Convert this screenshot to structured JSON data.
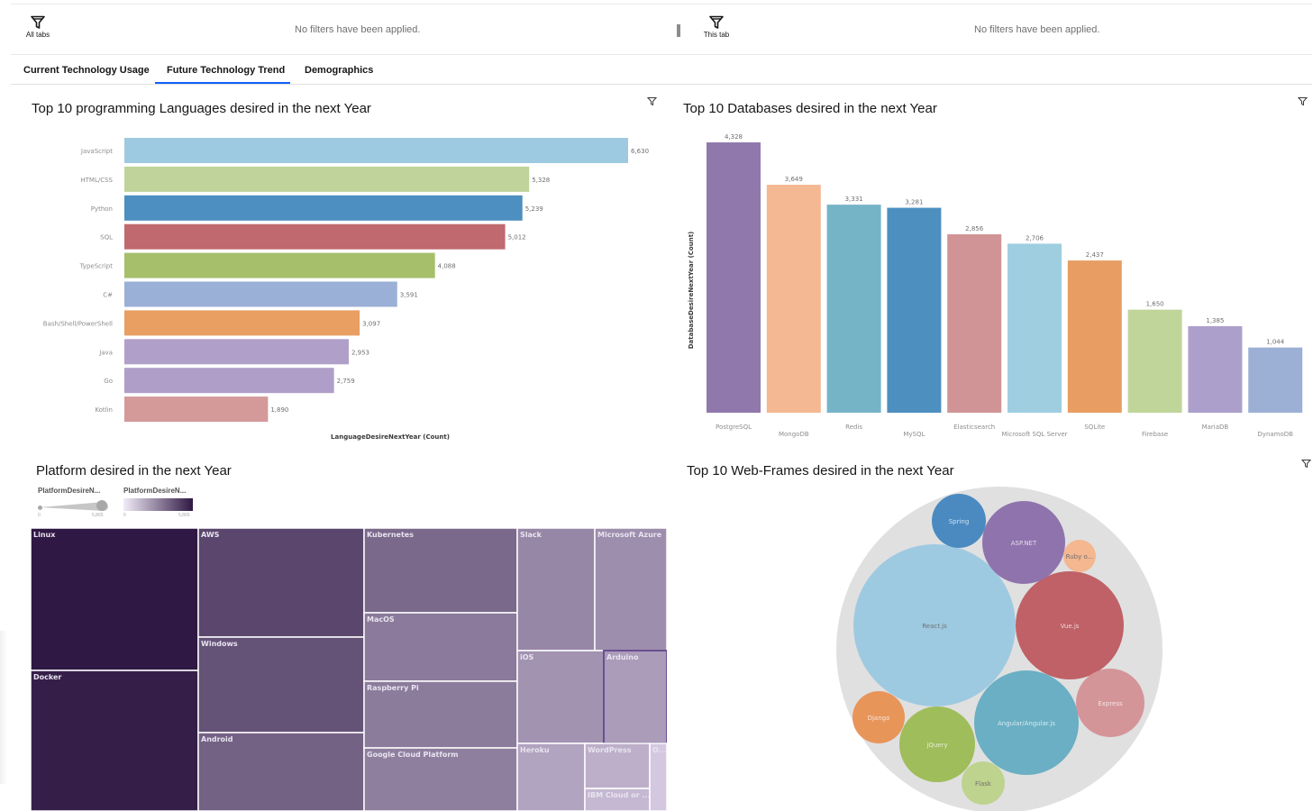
{
  "filters": {
    "all_tabs_label": "All tabs",
    "this_tab_label": "This tab",
    "left_message": "No filters have been applied.",
    "right_message": "No filters have been applied."
  },
  "tabs": [
    {
      "label": "Current Technology Usage",
      "active": false
    },
    {
      "label": "Future Technology Trend",
      "active": true
    },
    {
      "label": "Demographics",
      "active": false
    }
  ],
  "panels": {
    "languages_title": "Top 10 programming Languages desired in the next Year",
    "databases_title": "Top 10 Databases desired in the next Year",
    "platforms_title": "Platform desired in the next Year",
    "webframes_title": "Top 10 Web-Frames desired in the next Year"
  },
  "legend": {
    "size_title": "PlatformDesireN...",
    "color_title": "PlatformDesireN...",
    "size_min": "0",
    "size_max": "5,865",
    "color_min": "0",
    "color_max": "5,865"
  },
  "chart_data": [
    {
      "type": "bar",
      "orientation": "horizontal",
      "title": "Top 10 programming Languages desired in the next Year",
      "xlabel": "LanguageDesireNextYear (Count)",
      "ylabel": "",
      "categories": [
        "JavaScript",
        "HTML/CSS",
        "Python",
        "SQL",
        "TypeScript",
        "C#",
        "Bash/Shell/PowerShell",
        "Java",
        "Go",
        "Kotlin"
      ],
      "values": [
        6630,
        5328,
        5239,
        5012,
        4088,
        3591,
        3097,
        2953,
        2759,
        1890
      ],
      "value_labels": [
        "6,630",
        "5,328",
        "5,239",
        "5,012",
        "4,088",
        "3,591",
        "3,097",
        "2,953",
        "2,759",
        "1,890"
      ],
      "colors": [
        "#9ecae1",
        "#c0d39a",
        "#4d8fc0",
        "#c0696e",
        "#a5bf6b",
        "#9ab0d6",
        "#e99e62",
        "#b09fc9",
        "#ae9ec8",
        "#d49999"
      ],
      "xlim": [
        0,
        6630
      ]
    },
    {
      "type": "bar",
      "orientation": "vertical",
      "title": "Top 10 Databases desired in the next Year",
      "xlabel": "",
      "ylabel": "DatabaseDesireNextYear (Count)",
      "categories": [
        "PostgreSQL",
        "MongoDB",
        "Redis",
        "MySQL",
        "Elasticsearch",
        "Microsoft SQL Server",
        "SQLite",
        "Firebase",
        "MariaDB",
        "DynamoDB"
      ],
      "values": [
        4328,
        3649,
        3331,
        3281,
        2856,
        2706,
        2437,
        1650,
        1385,
        1044
      ],
      "value_labels": [
        "4,328",
        "3,649",
        "3,331",
        "3,281",
        "2,856",
        "2,706",
        "2,437",
        "1,650",
        "1,385",
        "1,044"
      ],
      "colors": [
        "#9078ad",
        "#f4b892",
        "#75b4c7",
        "#4d8fbf",
        "#d19496",
        "#9ecee0",
        "#e89e63",
        "#c0d59a",
        "#ad9fcb",
        "#9cb0d6"
      ],
      "ylim": [
        0,
        4328
      ]
    },
    {
      "type": "treemap",
      "title": "Platform desired in the next Year",
      "items": [
        {
          "name": "Linux",
          "value": 5865
        },
        {
          "name": "Docker",
          "value": 5600
        },
        {
          "name": "AWS",
          "value": 4100
        },
        {
          "name": "Windows",
          "value": 3700
        },
        {
          "name": "Android",
          "value": 3150
        },
        {
          "name": "Kubernetes",
          "value": 2900
        },
        {
          "name": "MacOS",
          "value": 2350
        },
        {
          "name": "Raspberry Pi",
          "value": 2300
        },
        {
          "name": "Google Cloud Platform",
          "value": 2200
        },
        {
          "name": "Slack",
          "value": 1950
        },
        {
          "name": "Microsoft Azure",
          "value": 1750
        },
        {
          "name": "iOS",
          "value": 1600
        },
        {
          "name": "Arduino",
          "value": 1350
        },
        {
          "name": "Heroku",
          "value": 1150
        },
        {
          "name": "WordPress",
          "value": 850
        },
        {
          "name": "IBM Cloud or ...",
          "value": 650
        },
        {
          "name": "O...",
          "value": 320
        }
      ]
    },
    {
      "type": "bubble",
      "title": "Top 10 Web-Frames desired in the next Year",
      "items": [
        {
          "name": "React.js",
          "value": 100
        },
        {
          "name": "Vue.js",
          "value": 44
        },
        {
          "name": "Angular/Angular.js",
          "value": 42
        },
        {
          "name": "ASP.NET",
          "value": 25
        },
        {
          "name": "jQuery",
          "value": 22
        },
        {
          "name": "Express",
          "value": 18
        },
        {
          "name": "Spring",
          "value": 11
        },
        {
          "name": "Django",
          "value": 10
        },
        {
          "name": "Flask",
          "value": 7
        },
        {
          "name": "Ruby o...",
          "value": 4
        }
      ],
      "colors": {
        "React.js": "#9ecae1",
        "Vue.js": "#bf6167",
        "Angular/Angular.js": "#6aafc3",
        "ASP.NET": "#8f73ad",
        "jQuery": "#9fbd5a",
        "Express": "#d49599",
        "Spring": "#4a8ac0",
        "Django": "#e8955a",
        "Flask": "#bed38e",
        "Ruby o...": "#f4b790"
      }
    }
  ]
}
